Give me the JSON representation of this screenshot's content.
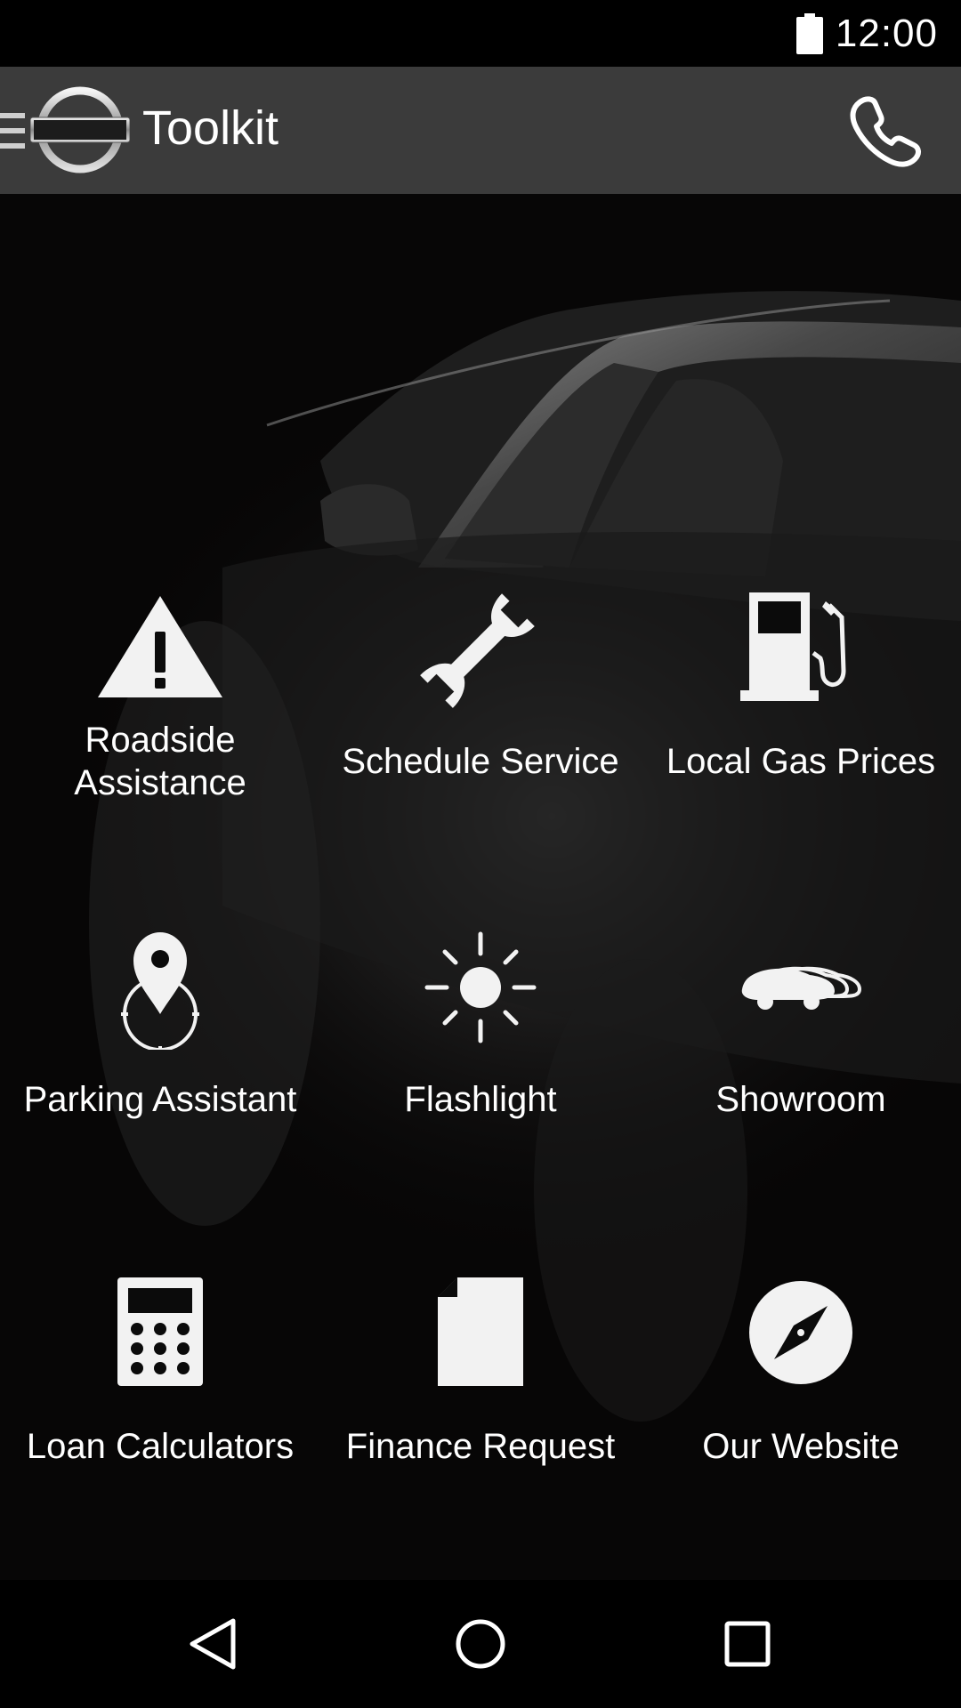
{
  "status_bar": {
    "time": "12:00",
    "battery_icon": "battery-full-icon"
  },
  "app_bar": {
    "menu_icon": "hamburger-menu-icon",
    "logo_text": "NISSAN",
    "title": "Toolkit",
    "call_icon": "phone-icon"
  },
  "grid": [
    {
      "icon": "warning-triangle-icon",
      "label_line1": "Roadside",
      "label_line2": "Assistance"
    },
    {
      "icon": "wrench-icon",
      "label": "Schedule Service"
    },
    {
      "icon": "gas-pump-icon",
      "label": "Local Gas Prices"
    },
    {
      "icon": "location-pin-icon",
      "label": "Parking Assistant"
    },
    {
      "icon": "sun-icon",
      "label": "Flashlight"
    },
    {
      "icon": "cars-icon",
      "label": "Showroom"
    },
    {
      "icon": "calculator-icon",
      "label": "Loan Calculators"
    },
    {
      "icon": "document-icon",
      "label": "Finance Request"
    },
    {
      "icon": "compass-icon",
      "label": "Our Website"
    }
  ],
  "nav_bar": {
    "back_icon": "back-triangle-icon",
    "home_icon": "home-circle-icon",
    "recents_icon": "recents-square-icon"
  },
  "colors": {
    "app_bar_bg": "#3b3b3b",
    "status_bg": "#000000",
    "content_bg": "#070606",
    "text": "#ffffff"
  }
}
